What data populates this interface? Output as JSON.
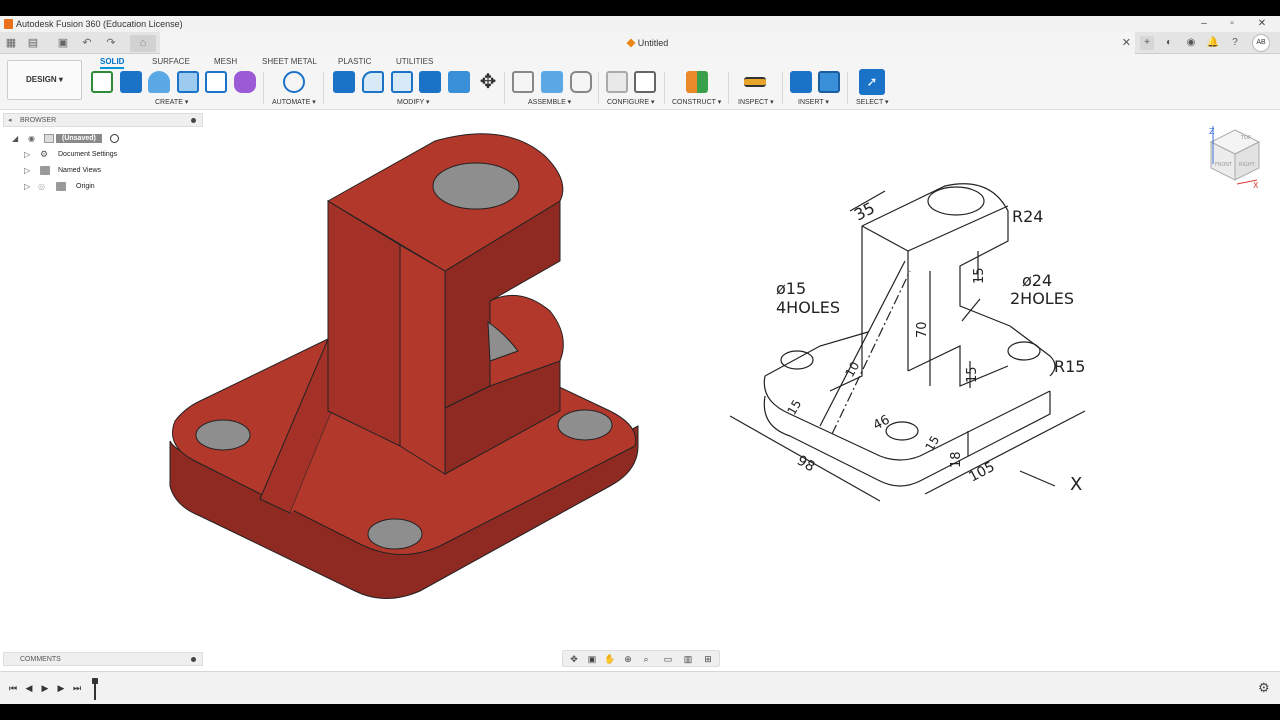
{
  "window": {
    "title": "Autodesk Fusion 360 (Education License)"
  },
  "tabs": {
    "document_title": "Untitled",
    "user_initials": "AB"
  },
  "toolbar": {
    "workspace": "DESIGN ▾",
    "tabs": [
      "SOLID",
      "SURFACE",
      "MESH",
      "SHEET METAL",
      "PLASTIC",
      "UTILITIES"
    ],
    "groups": [
      "CREATE ▾",
      "AUTOMATE ▾",
      "MODIFY ▾",
      "ASSEMBLE ▾",
      "CONFIGURE ▾",
      "CONSTRUCT ▾",
      "INSPECT ▾",
      "INSERT ▾",
      "SELECT ▾"
    ]
  },
  "browser": {
    "header": "BROWSER",
    "items": [
      "(Unsaved)",
      "Document Settings",
      "Named Views",
      "Origin"
    ]
  },
  "comments": {
    "header": "COMMENTS"
  },
  "viewcube": {
    "top_label": "TOP",
    "front_label": "FRONT",
    "right_label": "RIGHT",
    "axis_z": "Z",
    "axis_x": "X"
  },
  "drawing": {
    "dims": [
      "35",
      "R24",
      "ø24",
      "2HOLES",
      "ø15",
      "4HOLES",
      "15",
      "70",
      "10",
      "15",
      "R15",
      "15",
      "46",
      "15",
      "18",
      "98",
      "105",
      "X"
    ]
  },
  "colors": {
    "part": "#b3382c",
    "accent": "#0696d7"
  }
}
